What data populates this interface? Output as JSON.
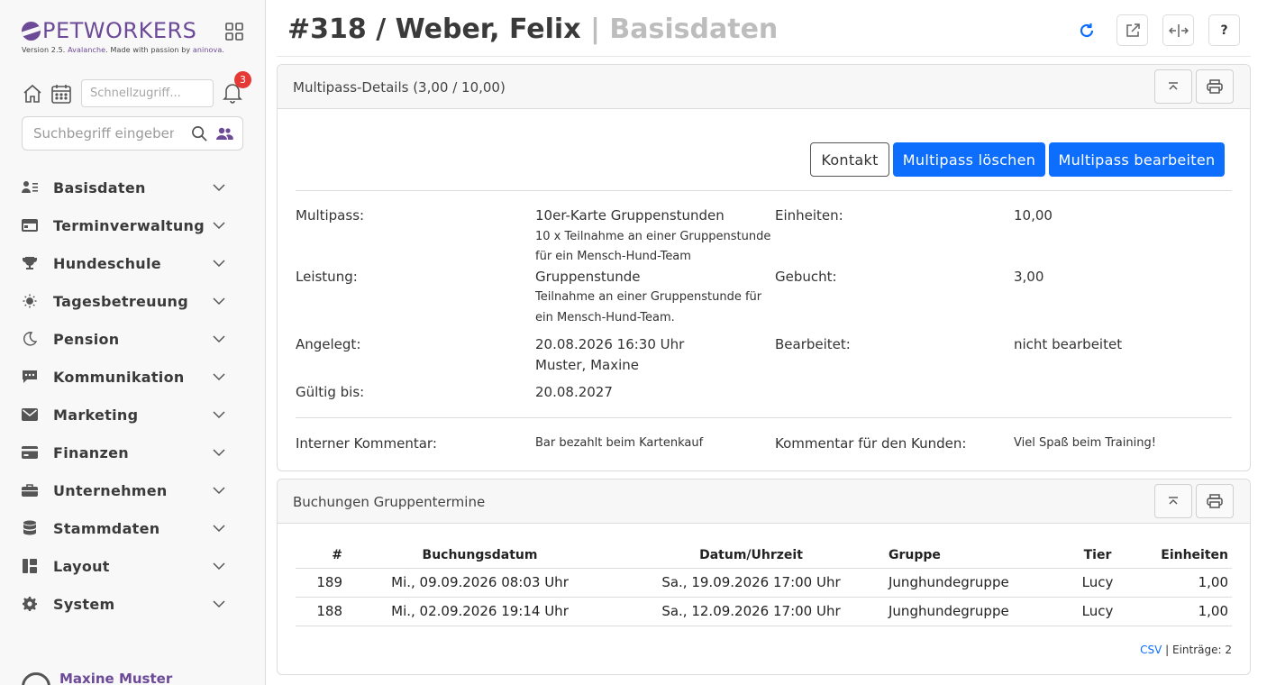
{
  "app": {
    "brand": "PETWORKERS",
    "version_prefix": "Version 2.5. ",
    "version_name": "Avalanche",
    "version_suffix": ". Made with passion by ",
    "vendor": "aninova",
    "vendor_suffix": "."
  },
  "quick": {
    "placeholder": "Schnellzugriff...",
    "notifications": "3"
  },
  "search": {
    "placeholder": "Suchbegriff eingeben"
  },
  "nav": [
    {
      "label": "Basisdaten",
      "icon": "person-list-icon"
    },
    {
      "label": "Terminverwaltung",
      "icon": "calendar-card-icon"
    },
    {
      "label": "Hundeschule",
      "icon": "trophy-icon"
    },
    {
      "label": "Tagesbetreuung",
      "icon": "sun-icon"
    },
    {
      "label": "Pension",
      "icon": "moon-icon"
    },
    {
      "label": "Kommunikation",
      "icon": "chat-icon"
    },
    {
      "label": "Marketing",
      "icon": "envelope-icon"
    },
    {
      "label": "Finanzen",
      "icon": "credit-card-icon"
    },
    {
      "label": "Unternehmen",
      "icon": "briefcase-icon"
    },
    {
      "label": "Stammdaten",
      "icon": "database-icon"
    },
    {
      "label": "Layout",
      "icon": "layout-icon"
    },
    {
      "label": "System",
      "icon": "gear-icon"
    }
  ],
  "user": {
    "name": "Maxine Muster"
  },
  "page": {
    "title": "#318 / Weber, Felix",
    "subtitle": " | Basisdaten"
  },
  "multipass": {
    "title": "Multipass-Details (3,00 / 10,00)",
    "btn_contact": "Kontakt",
    "btn_delete": "Multipass löschen",
    "btn_edit": "Multipass bearbeiten",
    "label_multipass": "Multipass:",
    "multipass_name": "10er-Karte Gruppenstunden",
    "multipass_desc_1": "10 x Teilnahme an einer Gruppenstunde",
    "multipass_desc_2": "für ein Mensch-Hund-Team",
    "label_units": "Einheiten:",
    "units": "10,00",
    "label_service": "Leistung:",
    "service_name": "Gruppenstunde",
    "service_desc_1": "Teilnahme an einer Gruppenstunde für",
    "service_desc_2": "ein Mensch-Hund-Team.",
    "label_booked": "Gebucht:",
    "booked": "3,00",
    "label_created": "Angelegt:",
    "created_date": "20.08.2026 16:30 Uhr",
    "created_by": "Muster, Maxine",
    "label_edited": "Bearbeitet:",
    "edited": "nicht bearbeitet",
    "label_valid": "Gültig bis:",
    "valid": "20.08.2027",
    "label_internal": "Interner Kommentar:",
    "internal": "Bar bezahlt beim Kartenkauf",
    "label_customer": "Kommentar für den Kunden:",
    "customer": "Viel Spaß beim Training!"
  },
  "bookings": {
    "title": "Buchungen Gruppentermine",
    "columns": [
      "#",
      "Buchungsdatum",
      "Datum/Uhrzeit",
      "Gruppe",
      "Tier",
      "Einheiten"
    ],
    "rows": [
      [
        "189",
        "Mi., 09.09.2026 08:03 Uhr",
        "Sa., 19.09.2026 17:00 Uhr",
        "Junghundegruppe",
        "Lucy",
        "1,00"
      ],
      [
        "188",
        "Mi., 02.09.2026 19:14 Uhr",
        "Sa., 12.09.2026 17:00 Uhr",
        "Junghundegruppe",
        "Lucy",
        "1,00"
      ]
    ],
    "csv": "CSV",
    "entries": " | Einträge: 2"
  },
  "colors": {
    "brand": "#6c4a97",
    "primary": "#0d6efd",
    "badge": "#e53935"
  }
}
